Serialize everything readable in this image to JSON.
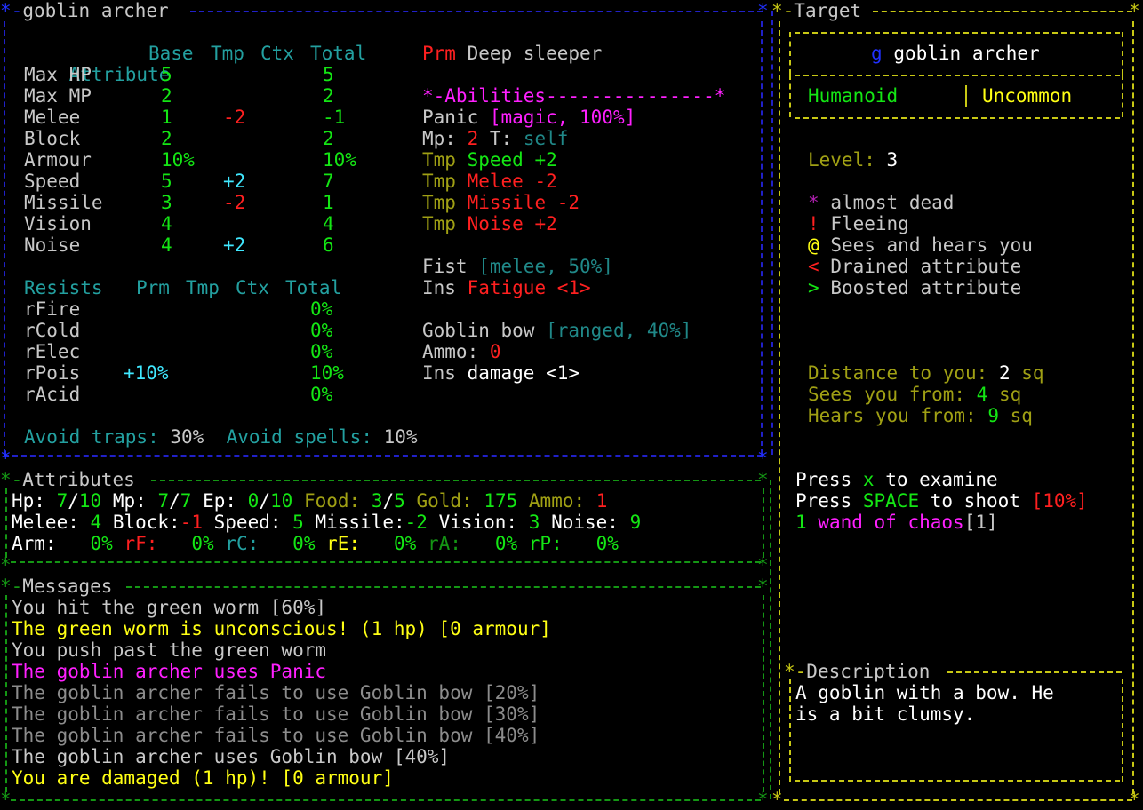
{
  "colors": {
    "blue_frame": "#2020c8",
    "green_frame": "#149614",
    "yellow_frame": "#c8c814",
    "teal": "#23a0a0",
    "green": "#14e614",
    "red": "#ff2020",
    "yellow": "#ffff14",
    "magenta": "#ff20ff"
  },
  "panels": {
    "char_title": "goblin archer",
    "attributes_title": "Attributes",
    "messages_title": "Messages",
    "target_title": "Target",
    "description_title": "Description"
  },
  "stats": {
    "headers": [
      "Attribute",
      "Base",
      "Tmp",
      "Ctx",
      "Total"
    ],
    "rows": [
      {
        "name": "Max HP",
        "base": "5",
        "tmp": "",
        "total": "5"
      },
      {
        "name": "Max MP",
        "base": "2",
        "tmp": "",
        "total": "2"
      },
      {
        "name": "Melee",
        "base": "1",
        "tmp": "-2",
        "total": "-1"
      },
      {
        "name": "Block",
        "base": "2",
        "tmp": "",
        "total": "2"
      },
      {
        "name": "Armour",
        "base": "10%",
        "tmp": "",
        "total": "10%"
      },
      {
        "name": "Speed",
        "base": "5",
        "tmp": "+2",
        "total": "7"
      },
      {
        "name": "Missile",
        "base": "3",
        "tmp": "-2",
        "total": "1"
      },
      {
        "name": "Vision",
        "base": "4",
        "tmp": "",
        "total": "4"
      },
      {
        "name": "Noise",
        "base": "4",
        "tmp": "+2",
        "total": "6"
      }
    ]
  },
  "resists": {
    "headers": [
      "Resists",
      "Prm",
      "Tmp",
      "Ctx",
      "Total"
    ],
    "rows": [
      {
        "name": "rFire",
        "prm": "",
        "total": "0%"
      },
      {
        "name": "rCold",
        "prm": "",
        "total": "0%"
      },
      {
        "name": "rElec",
        "prm": "",
        "total": "0%"
      },
      {
        "name": "rPois",
        "prm": "+10%",
        "total": "10%"
      },
      {
        "name": "rAcid",
        "prm": "",
        "total": "0%"
      }
    ],
    "avoid_traps_label": "Avoid traps:",
    "avoid_traps": "30%",
    "avoid_spells_label": "Avoid spells:",
    "avoid_spells": "10%"
  },
  "abilities": {
    "prm_tag": "Prm",
    "prm_value": "Deep sleeper",
    "header": "*-Abilities---------------*",
    "panic_name": "Panic",
    "panic_tag": "[magic, 100%]",
    "mp_label": "Mp:",
    "mp_value": "2",
    "t_label": "T:",
    "t_value": "self",
    "tmp_label": "Tmp",
    "effects": [
      "Speed +2",
      "Melee -2",
      "Missile -2",
      "Noise +2"
    ],
    "fist_name": "Fist",
    "fist_tag": "[melee, 50%]",
    "ins_label": "Ins",
    "fatigue": "Fatigue <1>",
    "bow_name": "Goblin bow",
    "bow_tag": "[ranged, 40%]",
    "ammo_label": "Ammo:",
    "ammo_value": "0",
    "damage": "damage <1>"
  },
  "attributes_bar": {
    "hp_label": "Hp:",
    "hp": "7",
    "hp_max": "10",
    "mp_label": "Mp:",
    "mp": "7",
    "mp_max": "7",
    "ep_label": "Ep:",
    "ep": "0",
    "ep_max": "10",
    "food_label": "Food:",
    "food": "3",
    "food_max": "5",
    "gold_label": "Gold:",
    "gold": "175",
    "ammo_label": "Ammo:",
    "ammo": "1",
    "melee_label": "Melee:",
    "melee": "4",
    "block_label": "Block:",
    "block": "-1",
    "speed_label": "Speed:",
    "speed": "5",
    "missile_label": "Missile:",
    "missile": "-2",
    "vision_label": "Vision:",
    "vision": "3",
    "noise_label": "Noise:",
    "noise": "9",
    "arm_label": "Arm:",
    "arm": "0%",
    "rf_label": "rF:",
    "rf": "0%",
    "rc_label": "rC:",
    "rc": "0%",
    "re_label": "rE:",
    "re": "0%",
    "ra_label": "rA:",
    "ra": "0%",
    "rp_label": "rP:",
    "rp": "0%"
  },
  "messages": [
    {
      "text": "You hit the green worm [60%]",
      "color": "#c8c8c8"
    },
    {
      "text": "The green worm is unconscious! (1 hp) [0 armour]",
      "color": "#ffff14"
    },
    {
      "text": "You push past the green worm",
      "color": "#c8c8c8"
    },
    {
      "text": "The goblin archer uses Panic",
      "color": "#ff20ff"
    },
    {
      "text": "The goblin archer fails to use Goblin bow [20%]",
      "color": "#8c8c8c"
    },
    {
      "text": "The goblin archer fails to use Goblin bow [30%]",
      "color": "#8c8c8c"
    },
    {
      "text": "The goblin archer fails to use Goblin bow [40%]",
      "color": "#8c8c8c"
    },
    {
      "text": "The goblin archer uses Goblin bow [40%]",
      "color": "#c8c8c8"
    },
    {
      "text": "You are damaged (1 hp)! [0 armour]",
      "color": "#ffff14"
    }
  ],
  "target": {
    "glyph": "g",
    "name": "goblin archer",
    "type": "Humanoid",
    "rarity": "Uncommon",
    "level_label": "Level:",
    "level": "3",
    "legend": [
      {
        "glyph": "*",
        "text": "almost dead"
      },
      {
        "glyph": "!",
        "text": "Fleeing"
      },
      {
        "glyph": "@",
        "text": "Sees and hears you"
      },
      {
        "glyph": "<",
        "text": "Drained attribute"
      },
      {
        "glyph": ">",
        "text": "Boosted attribute"
      }
    ],
    "distance_label": "Distance to you:",
    "distance": "2",
    "distance_unit": "sq",
    "sees_label": "Sees you from:",
    "sees": "4",
    "sees_unit": "sq",
    "hears_label": "Hears you from:",
    "hears": "9",
    "hears_unit": "sq",
    "press": "Press",
    "examine_key": "x",
    "examine_text": "to examine",
    "shoot_key": "SPACE",
    "shoot_text": "to shoot",
    "shoot_chance": "[10%]",
    "wand_count": "1",
    "wand_name": "wand of chaos",
    "wand_charges": "[1]"
  },
  "description": {
    "line1": "A goblin with a bow. He",
    "line2": "is a bit clumsy."
  }
}
